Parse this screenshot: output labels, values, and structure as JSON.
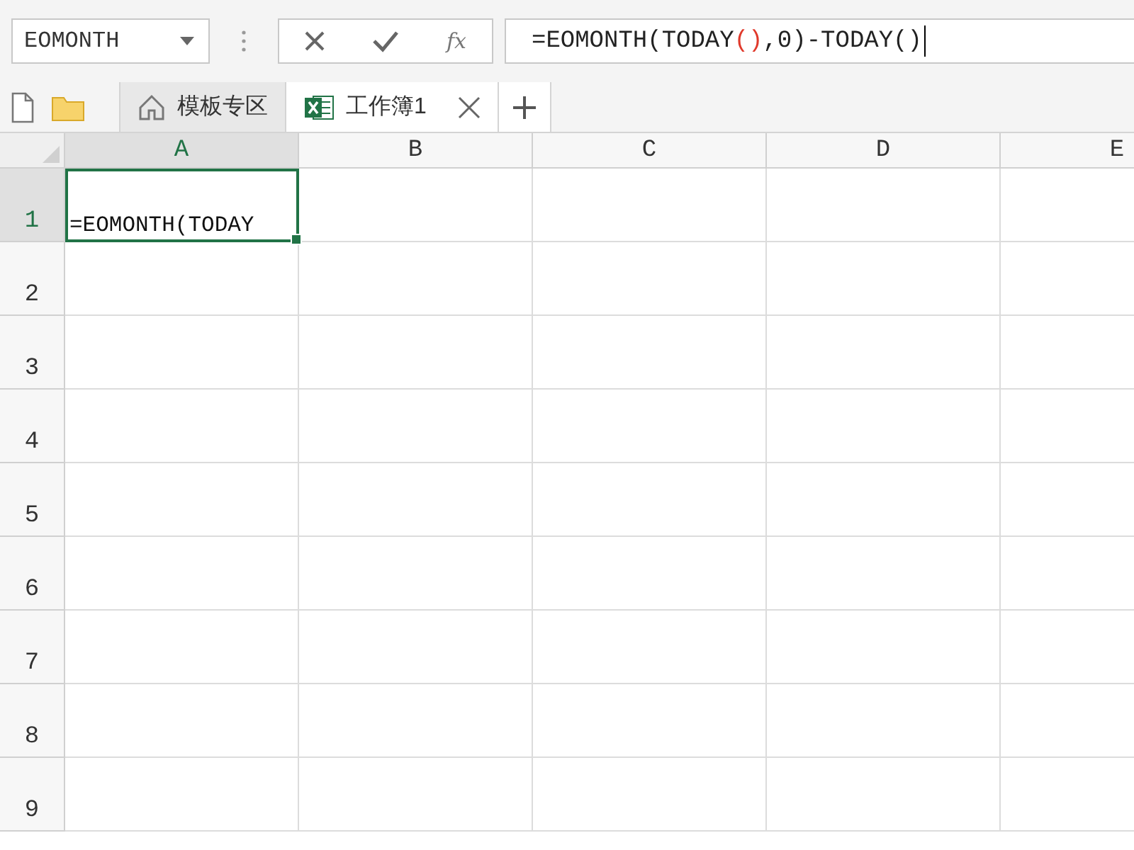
{
  "name_box": {
    "value": "EOMONTH"
  },
  "formula_buttons": [
    {
      "kind": "cancel"
    },
    {
      "kind": "confirm"
    },
    {
      "kind": "function",
      "label": "fx"
    }
  ],
  "formula_bar": {
    "segments": [
      {
        "text": "=EOMONTH(TODAY",
        "highlight": false
      },
      {
        "text": "()",
        "highlight": true
      },
      {
        "text": ",0)-TODAY()",
        "highlight": false
      }
    ]
  },
  "tabs": [
    {
      "label": "模板专区",
      "kind": "template",
      "selected": false
    },
    {
      "label": "工作簿1",
      "kind": "workbook",
      "selected": true
    }
  ],
  "columns": [
    {
      "label": "A",
      "selected": true
    },
    {
      "label": "B",
      "selected": false
    },
    {
      "label": "C",
      "selected": false
    },
    {
      "label": "D",
      "selected": false
    },
    {
      "label": "E",
      "selected": false
    }
  ],
  "rows": [
    {
      "label": "1",
      "selected": true,
      "value": "=EOMONTH(TODAY"
    },
    {
      "label": "2",
      "selected": false
    },
    {
      "label": "3",
      "selected": false
    },
    {
      "label": "4",
      "selected": false
    },
    {
      "label": "5",
      "selected": false
    },
    {
      "label": "6",
      "selected": false
    },
    {
      "label": "7",
      "selected": false
    },
    {
      "label": "8",
      "selected": false
    },
    {
      "label": "9",
      "selected": false
    }
  ]
}
